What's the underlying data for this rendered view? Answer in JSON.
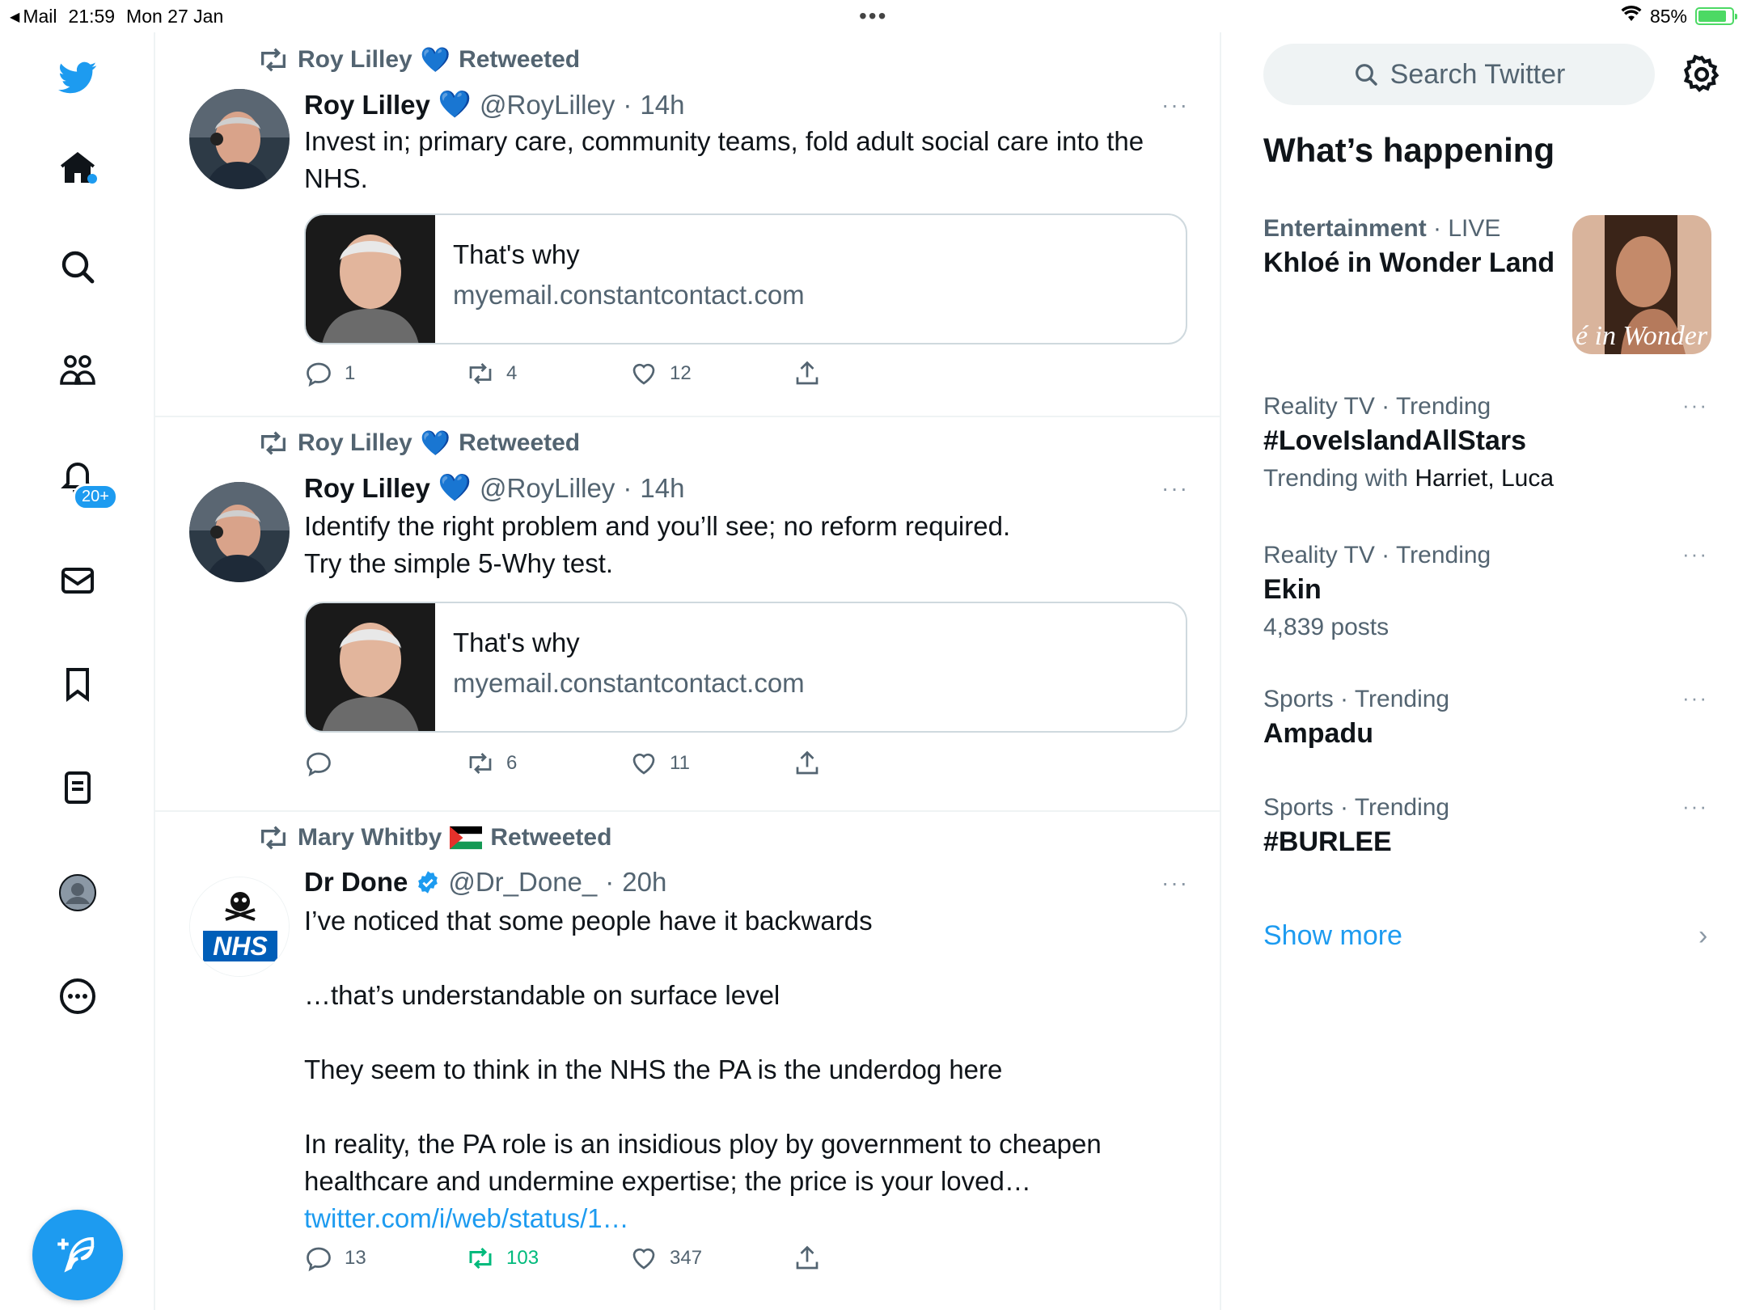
{
  "status_bar": {
    "back_app": "Mail",
    "time": "21:59",
    "date": "Mon 27 Jan",
    "battery": "85%",
    "battery_level": 0.85
  },
  "nav": {
    "notification_badge": "20+"
  },
  "tweets": [
    {
      "retweeter": "Roy Lilley",
      "retweet_label": "Retweeted",
      "name": "Roy Lilley",
      "handle": "@RoyLilley",
      "sep": "·",
      "time": "14h",
      "more": "···",
      "text": [
        "Invest in; primary care, community teams, fold adult social care into the NHS."
      ],
      "card": {
        "title": "That's why",
        "domain": "myemail.constantcontact.com"
      },
      "actions": {
        "replies": "1",
        "retweets": "4",
        "likes": "12"
      }
    },
    {
      "retweeter": "Roy Lilley",
      "retweet_label": "Retweeted",
      "name": "Roy Lilley",
      "handle": "@RoyLilley",
      "sep": "·",
      "time": "14h",
      "more": "···",
      "text": [
        "Identify the right problem and you’ll see; no reform required.",
        "Try the simple 5-Why test."
      ],
      "card": {
        "title": "That's why",
        "domain": "myemail.constantcontact.com"
      },
      "actions": {
        "replies": "",
        "retweets": "6",
        "likes": "11"
      }
    },
    {
      "retweeter": "Mary Whitby",
      "retweet_label": "Retweeted",
      "name": "Dr Done",
      "handle": "@Dr_Done_",
      "sep": "·",
      "time": "20h",
      "more": "···",
      "avatar_text": "NHS",
      "text": [
        "I’ve noticed that some people have it backwards",
        "…that’s understandable on surface level",
        "They seem to think in the NHS the PA is the underdog here",
        "In reality, the PA role is an insidious ploy by government to cheapen healthcare and undermine expertise; the price is your loved…"
      ],
      "link": "twitter.com/i/web/status/1…",
      "actions": {
        "replies": "13",
        "retweets": "103",
        "likes": "347"
      }
    }
  ],
  "sidebar": {
    "search_placeholder": "Search Twitter",
    "whats_happening": "What’s happening",
    "trends": [
      {
        "category": "Entertainment",
        "sep": " · ",
        "status": "LIVE",
        "title": "Khloé in Wonder Land",
        "image_caption": "é in Wonder L"
      },
      {
        "category": "Reality TV · Trending",
        "more": "···",
        "title": "#LoveIslandAllStars",
        "sub_prefix": "Trending with ",
        "sub_names": "Harriet, Luca"
      },
      {
        "category": "Reality TV · Trending",
        "more": "···",
        "title": "Ekin",
        "sub": "4,839 posts"
      },
      {
        "category": "Sports · Trending",
        "more": "···",
        "title": "Ampadu"
      },
      {
        "category": "Sports · Trending",
        "more": "···",
        "title": "#BURLEE"
      }
    ],
    "show_more": "Show more",
    "chevron": "›"
  },
  "colors": {
    "accent": "#1d9bf0",
    "retweet_green": "#00ba7c",
    "muted": "#536471",
    "border": "#eff3f4"
  }
}
